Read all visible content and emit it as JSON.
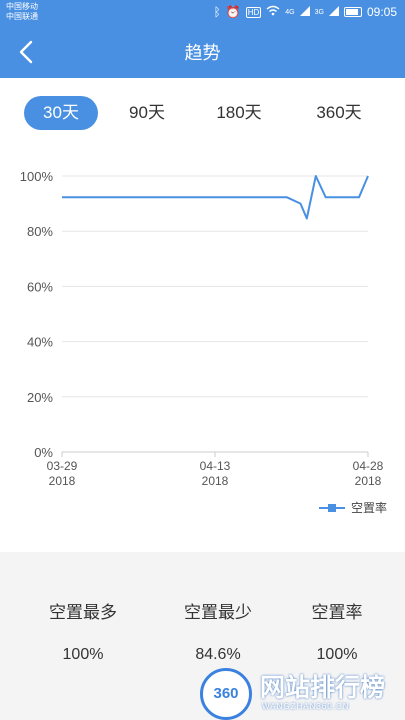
{
  "status": {
    "carrier1": "中国移动",
    "carrier2": "中国联通",
    "signal_tag": "HD",
    "network_tag": "4G",
    "network_tag2": "3G",
    "time": "09:05"
  },
  "nav": {
    "title": "趋势"
  },
  "tabs": [
    {
      "label": "30天",
      "active": true
    },
    {
      "label": "90天"
    },
    {
      "label": "180天"
    },
    {
      "label": "360天"
    }
  ],
  "chart_data": {
    "type": "line",
    "x": [
      "03-29 2018",
      "04-13 2018",
      "04-28 2018"
    ],
    "x_ticks": [
      {
        "line1": "03-29",
        "line2": "2018"
      },
      {
        "line1": "04-13",
        "line2": "2018"
      },
      {
        "line1": "04-28",
        "line2": "2018"
      }
    ],
    "y_ticks": [
      "100%",
      "80%",
      "60%",
      "40%",
      "20%",
      "0%"
    ],
    "ylim": [
      0,
      100
    ],
    "series": [
      {
        "name": "空置率",
        "points": [
          [
            0,
            92.3
          ],
          [
            25,
            92.3
          ],
          [
            26.5,
            90
          ],
          [
            27.2,
            84.6
          ],
          [
            28.2,
            100
          ],
          [
            29.3,
            92.3
          ],
          [
            32,
            92.3
          ],
          [
            33,
            92.3
          ],
          [
            34,
            100
          ]
        ]
      }
    ],
    "x_range": [
      0,
      34
    ],
    "colors": {
      "line": "#4a90e2",
      "grid": "#e6e6e6"
    }
  },
  "stats": [
    {
      "label": "空置最多",
      "value": "100%"
    },
    {
      "label": "空置最少",
      "value": "84.6%"
    },
    {
      "label": "空置率",
      "value": "100%"
    }
  ],
  "watermark": {
    "logo_text": "360",
    "title": "网站排行榜",
    "subtitle": "WANGZHAN360.CN"
  }
}
